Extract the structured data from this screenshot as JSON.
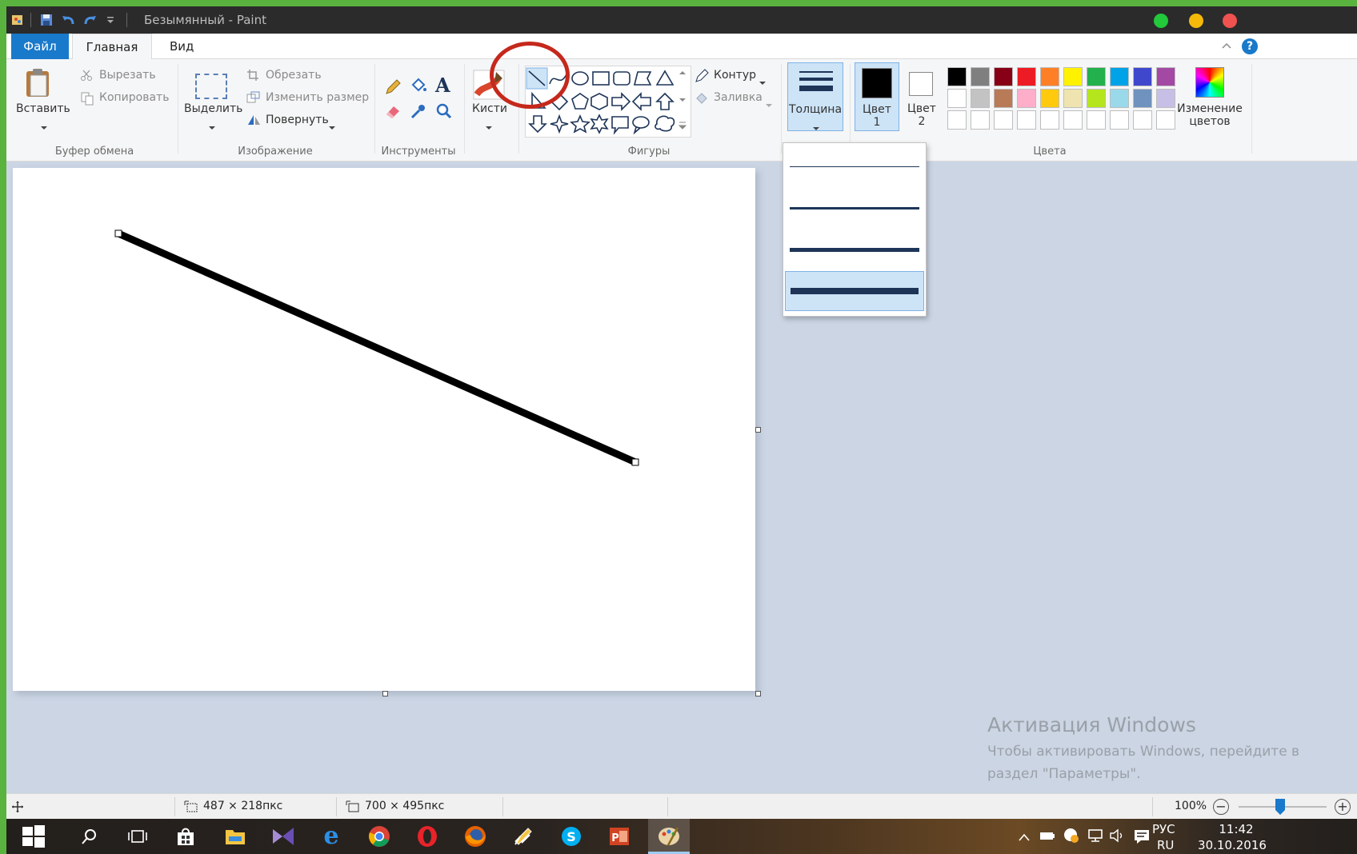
{
  "window": {
    "title": "Безымянный - Paint"
  },
  "menu": {
    "file": "Файл",
    "home": "Главная",
    "view": "Вид"
  },
  "ribbon": {
    "clipboard": {
      "paste": "Вставить",
      "cut": "Вырезать",
      "copy": "Копировать",
      "group": "Буфер обмена"
    },
    "image": {
      "select": "Выделить",
      "crop": "Обрезать",
      "resize": "Изменить размер",
      "rotate": "Повернуть",
      "group": "Изображение"
    },
    "tools": {
      "group": "Инструменты"
    },
    "brushes": {
      "label": "Кисти"
    },
    "shapes": {
      "outline": "Контур",
      "fill": "Заливка",
      "group": "Фигуры"
    },
    "size": {
      "label": "Толщина"
    },
    "colors": {
      "color1_line1": "Цвет",
      "color1_line2": "1",
      "color2_line1": "Цвет",
      "color2_line2": "2",
      "edit_line1": "Изменение",
      "edit_line2": "цветов",
      "group": "Цвета",
      "palette_row1": [
        "#000000",
        "#7f7f7f",
        "#880015",
        "#ed1c24",
        "#ff7f27",
        "#fff200",
        "#22b14c",
        "#00a2e8",
        "#3f48cc",
        "#a349a4"
      ],
      "palette_row2": [
        "#ffffff",
        "#c3c3c3",
        "#b97a57",
        "#ffaec9",
        "#ffc90e",
        "#efe4b0",
        "#b5e61d",
        "#99d9ea",
        "#7092be",
        "#c8bfe7"
      ]
    }
  },
  "size_options": [
    1,
    3,
    5,
    8
  ],
  "size_selected_index": 3,
  "canvas": {
    "stroke_color": "#000000"
  },
  "watermark": {
    "title": "Активация Windows",
    "subtitle": "Чтобы активировать Windows, перейдите в раздел \"Параметры\"."
  },
  "status": {
    "selection_size": "487 × 218пкс",
    "canvas_size": "700 × 495пкс",
    "zoom": "100%"
  },
  "taskbar": {
    "lang_top": "РУС",
    "lang_bottom": "RU",
    "time": "11:42",
    "date": "30.10.2016"
  }
}
